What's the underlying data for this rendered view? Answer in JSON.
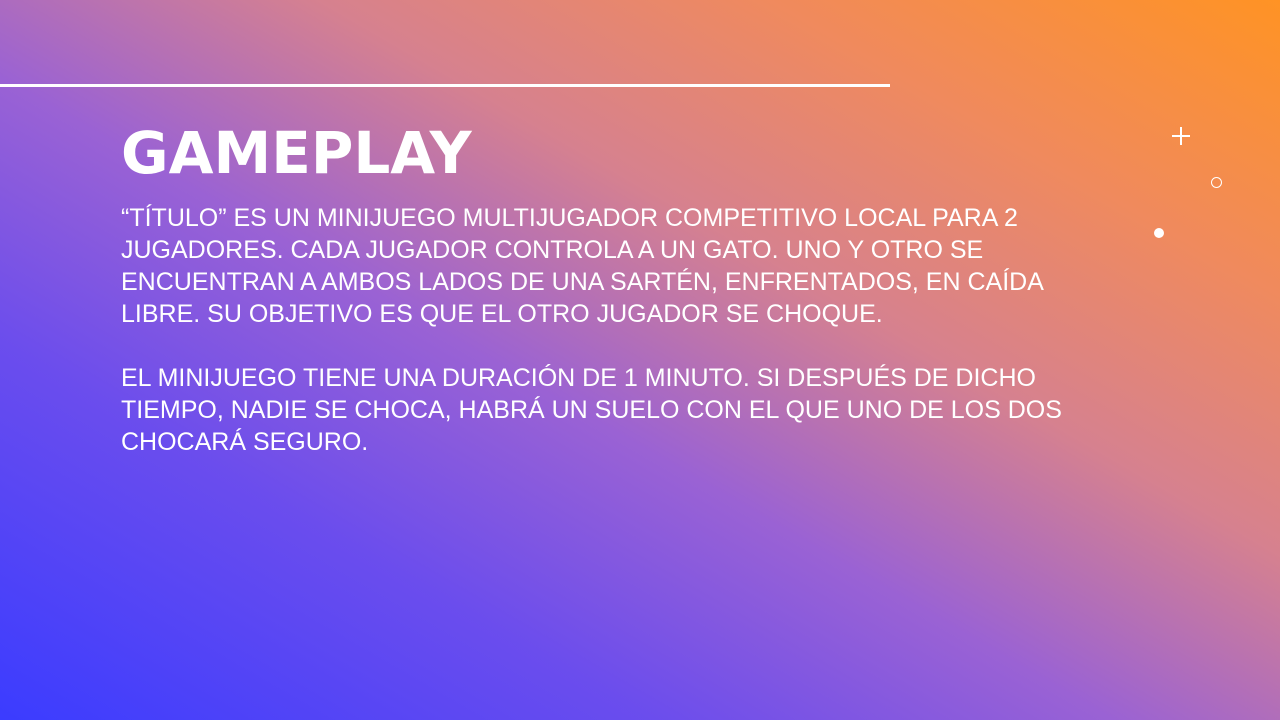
{
  "slide": {
    "title": "GAMEPLAY",
    "paragraphs": [
      "“TÍTULO” ES UN MINIJUEGO MULTIJUGADOR COMPETITIVO LOCAL PARA 2 JUGADORES. CADA JUGADOR CONTROLA A UN GATO. UNO Y OTRO SE ENCUENTRAN A AMBOS LADOS DE UNA SARTÉN, ENFRENTADOS, EN CAÍDA LIBRE. SU OBJETIVO ES QUE EL OTRO JUGADOR SE CHOQUE.",
      "EL MINIJUEGO TIENE UNA DURACIÓN DE 1 MINUTO. SI DESPUÉS DE DICHO TIEMPO, NADIE SE CHOCA, HABRÁ UN SUELO CON EL QUE UNO DE LOS DOS CHOCARÁ SEGURO."
    ]
  },
  "colors": {
    "gradient_top_right": "#ff9324",
    "gradient_bottom_left": "#3b3cff",
    "text": "#ffffff"
  },
  "icons": {
    "plus": "plus-icon",
    "ring": "circle-outline-icon",
    "dot": "dot-icon"
  }
}
